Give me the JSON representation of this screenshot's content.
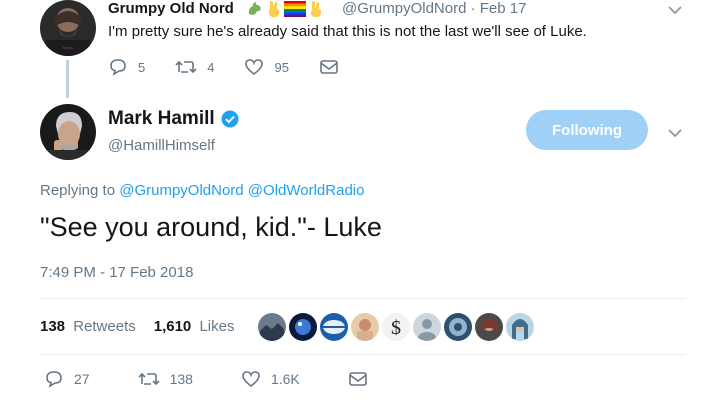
{
  "parent_tweet": {
    "author_name": "Grumpy Old Nord",
    "name_emojis": [
      "dragon-emoji-icon",
      "victory-hand-emoji-icon",
      "rainbow-flag-emoji-icon",
      "victory-hand-emoji-icon"
    ],
    "handle_date": "@GrumpyOldNord · Feb 17",
    "text": "I'm pretty sure he's already said that this is not the last we'll see of Luke.",
    "reply_count": "5",
    "retweet_count": "4",
    "like_count": "95"
  },
  "main_tweet": {
    "author_name": "Mark Hamill",
    "handle": "@HamillHimself",
    "follow_label": "Following",
    "replying_prefix": "Replying to",
    "replying_handles": "@GrumpyOldNord @OldWorldRadio",
    "text": "\"See you around, kid.\"- Luke",
    "timestamp": "7:49 PM - 17 Feb 2018",
    "retweets_count": "138",
    "retweets_label": "Retweets",
    "likes_count": "1,610",
    "likes_label": "Likes",
    "reply_count": "27",
    "retweet_count": "138",
    "like_count": "1.6K"
  },
  "colors": {
    "accent": "#1da1f2",
    "follow_button": "#9fd0f5",
    "muted_text": "#657786",
    "verified": "#1da1f2"
  }
}
